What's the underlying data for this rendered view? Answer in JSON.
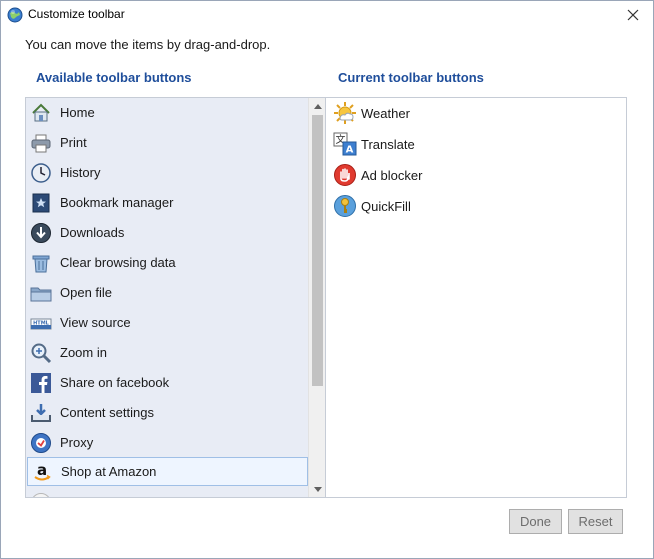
{
  "window": {
    "title": "Customize toolbar"
  },
  "instruction": "You can move the items by drag-and-drop.",
  "available": {
    "heading": "Available toolbar buttons",
    "items": [
      {
        "label": "Home",
        "icon": "home-icon"
      },
      {
        "label": "Print",
        "icon": "printer-icon"
      },
      {
        "label": "History",
        "icon": "clock-icon"
      },
      {
        "label": "Bookmark manager",
        "icon": "bookmark-book-icon"
      },
      {
        "label": "Downloads",
        "icon": "download-arrow-icon"
      },
      {
        "label": "Clear browsing data",
        "icon": "trash-icon"
      },
      {
        "label": "Open file",
        "icon": "folder-icon"
      },
      {
        "label": "View source",
        "icon": "html-source-icon"
      },
      {
        "label": "Zoom in",
        "icon": "magnifier-icon"
      },
      {
        "label": "Share on facebook",
        "icon": "facebook-icon"
      },
      {
        "label": "Content settings",
        "icon": "content-download-icon"
      },
      {
        "label": "Proxy",
        "icon": "proxy-icon"
      },
      {
        "label": "Shop at Amazon",
        "icon": "amazon-icon",
        "selected": true
      }
    ]
  },
  "current": {
    "heading": "Current toolbar buttons",
    "items": [
      {
        "label": "Weather",
        "icon": "weather-sun-icon"
      },
      {
        "label": "Translate",
        "icon": "translate-icon"
      },
      {
        "label": "Ad blocker",
        "icon": "ad-blocker-hand-icon"
      },
      {
        "label": "QuickFill",
        "icon": "quickfill-key-icon"
      }
    ]
  },
  "buttons": {
    "done": "Done",
    "reset": "Reset"
  },
  "colors": {
    "heading": "#1f4e9b",
    "left_list_bg": "#e8ecf5",
    "selection_border": "#9fbfe6"
  }
}
